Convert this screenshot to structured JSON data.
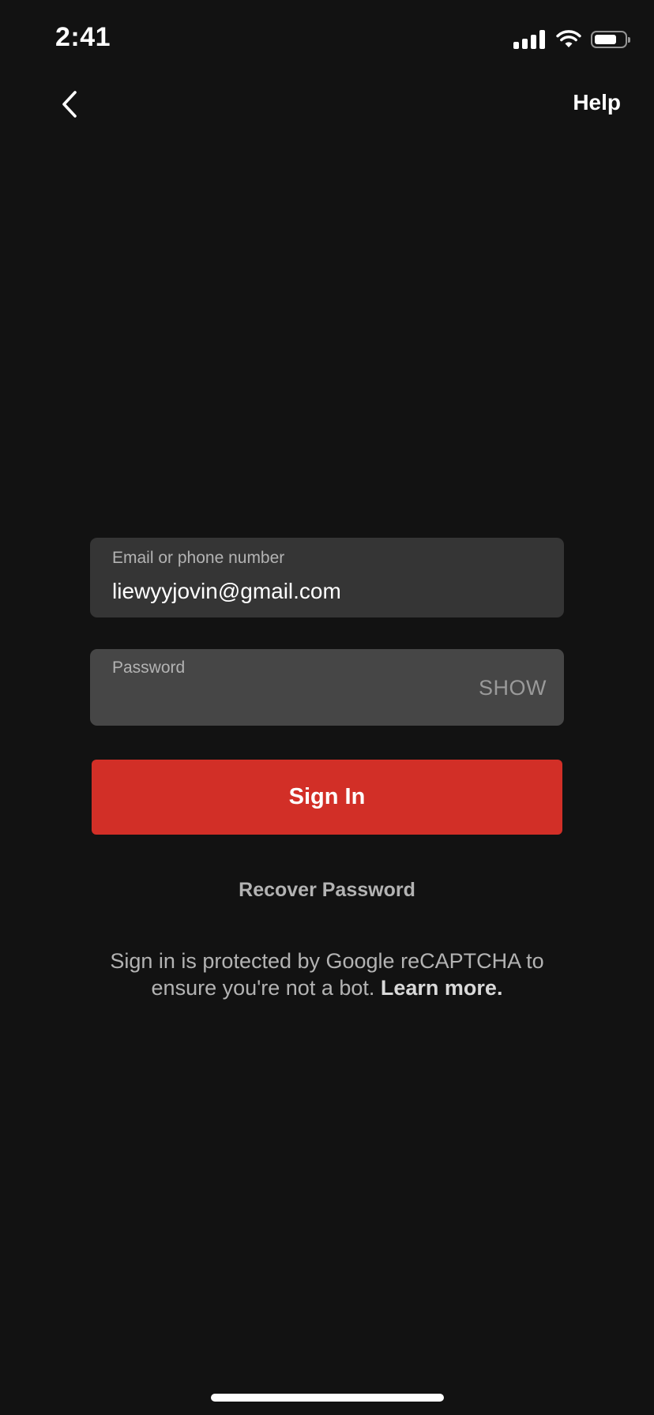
{
  "status_bar": {
    "time": "2:41",
    "signal_icon": "cellular-signal-icon",
    "wifi_icon": "wifi-icon",
    "battery_icon": "battery-icon",
    "battery_level": 0.78
  },
  "nav": {
    "back_icon": "chevron-left-icon",
    "help_label": "Help"
  },
  "form": {
    "email_label": "Email or phone number",
    "email_value": "liewyyjovin@gmail.com",
    "password_label": "Password",
    "password_value": "",
    "show_label": "SHOW",
    "sign_in_label": "Sign In",
    "recover_label": "Recover Password"
  },
  "recaptcha": {
    "text": "Sign in is protected by Google reCAPTCHA to ensure you're not a bot.",
    "learn_more": "Learn more."
  },
  "colors": {
    "background": "#121212",
    "brand_red": "#d22f27",
    "field_bg": "#353535",
    "field_bg_active": "#464646",
    "muted_text": "#b3b3b3"
  }
}
